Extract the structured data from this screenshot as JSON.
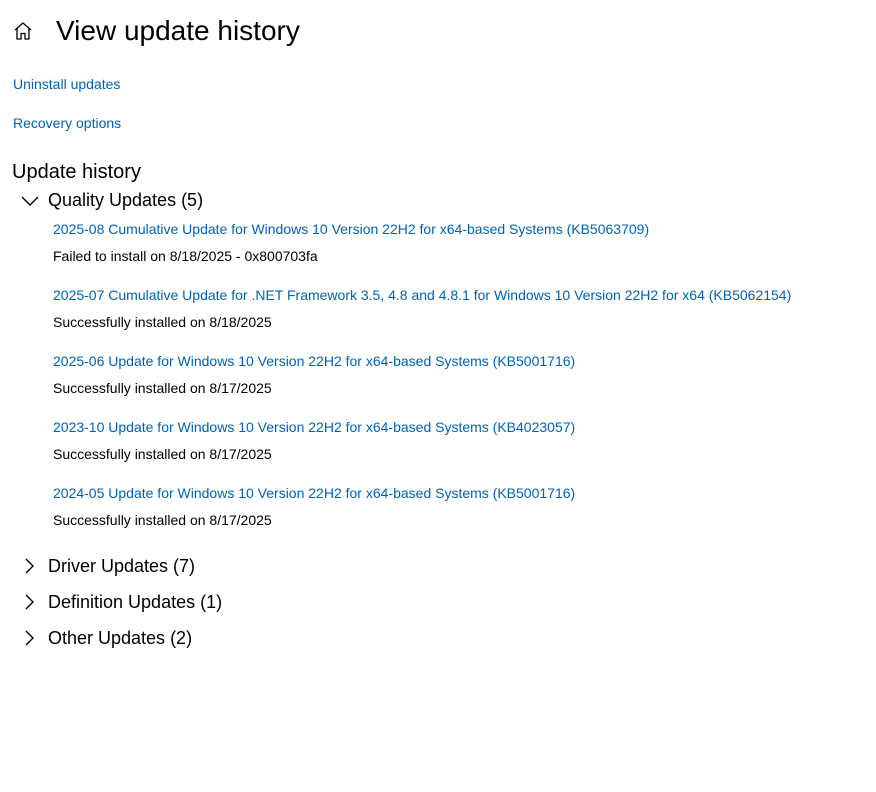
{
  "header": {
    "title": "View update history",
    "home_icon": "home-icon"
  },
  "links": {
    "uninstall": "Uninstall updates",
    "recovery": "Recovery options"
  },
  "history": {
    "title": "Update history",
    "groups": [
      {
        "label": "Quality Updates (5)",
        "expanded": true,
        "icon": "chevron-down-icon",
        "items": [
          {
            "title": "2025-08 Cumulative Update for Windows 10 Version 22H2 for x64-based Systems (KB5063709)",
            "status": "Failed to install on 8/18/2025 - 0x800703fa"
          },
          {
            "title": "2025-07 Cumulative Update for .NET Framework 3.5, 4.8 and 4.8.1 for Windows 10 Version 22H2 for x64 (KB5062154)",
            "status": "Successfully installed on 8/18/2025"
          },
          {
            "title": "2025-06 Update for Windows 10 Version 22H2 for x64-based Systems (KB5001716)",
            "status": "Successfully installed on 8/17/2025"
          },
          {
            "title": "2023-10 Update for Windows 10 Version 22H2 for x64-based Systems (KB4023057)",
            "status": "Successfully installed on 8/17/2025"
          },
          {
            "title": "2024-05 Update for Windows 10 Version 22H2 for x64-based Systems (KB5001716)",
            "status": "Successfully installed on 8/17/2025"
          }
        ]
      },
      {
        "label": "Driver Updates (7)",
        "expanded": false,
        "icon": "chevron-right-icon"
      },
      {
        "label": "Definition Updates (1)",
        "expanded": false,
        "icon": "chevron-right-icon"
      },
      {
        "label": "Other Updates (2)",
        "expanded": false,
        "icon": "chevron-right-icon"
      }
    ]
  },
  "colors": {
    "link": "#0063b1",
    "text": "#000000",
    "background": "#ffffff"
  }
}
